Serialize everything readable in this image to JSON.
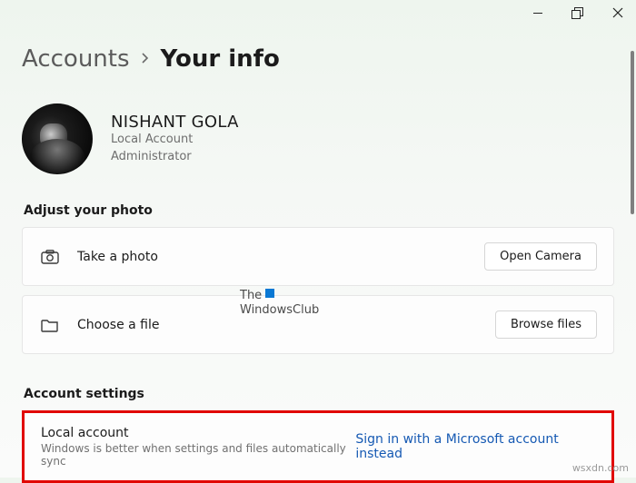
{
  "window": {
    "parent_crumb": "Accounts",
    "current_crumb": "Your info"
  },
  "profile": {
    "name": "NISHANT GOLA",
    "account_type": "Local Account",
    "role": "Administrator"
  },
  "sections": {
    "photo_title": "Adjust your photo",
    "settings_title": "Account settings"
  },
  "photo": {
    "take_label": "Take a photo",
    "take_button": "Open Camera",
    "choose_label": "Choose a file",
    "choose_button": "Browse files"
  },
  "account_settings": {
    "title": "Local account",
    "desc": "Windows is better when settings and files automatically sync",
    "link": "Sign in with a Microsoft account instead"
  },
  "watermark": {
    "line1": "The",
    "line2": "WindowsClub"
  },
  "credit": "wsxdn.com"
}
